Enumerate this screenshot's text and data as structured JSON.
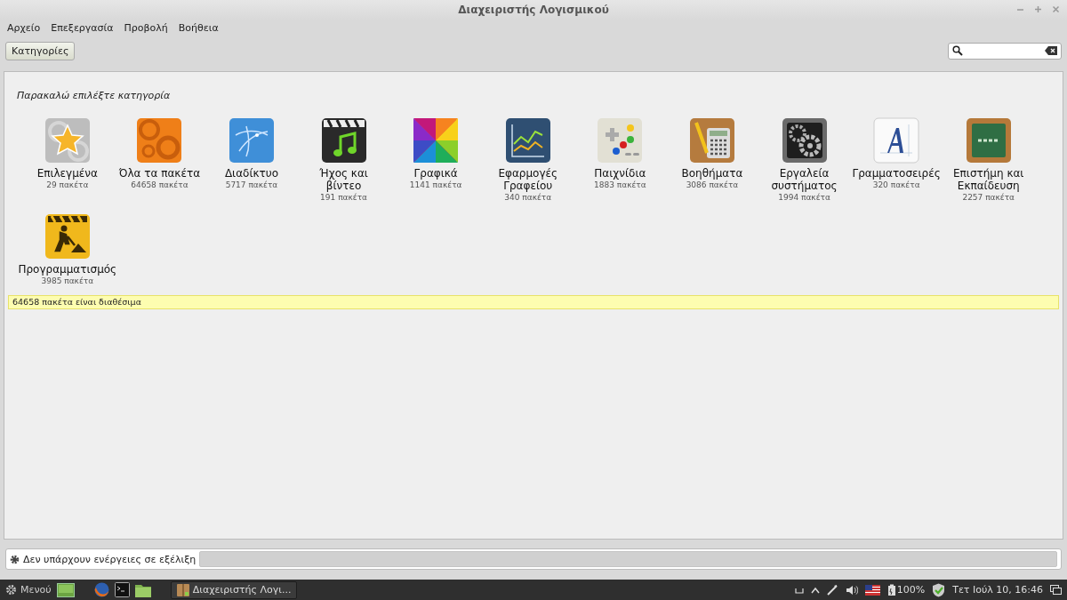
{
  "window": {
    "title": "Διαχειριστής Λογισμικού"
  },
  "menu": [
    "Αρχείο",
    "Επεξεργασία",
    "Προβολή",
    "Βοήθεια"
  ],
  "toolbar": {
    "button": "Κατηγορίες"
  },
  "heading": "Παρακαλώ επιλέξτε κατηγορία",
  "categories": [
    {
      "name": "Επιλεγμένα",
      "count": "29 πακέτα"
    },
    {
      "name": "Όλα τα πακέτα",
      "count": "64658 πακέτα"
    },
    {
      "name": "Διαδίκτυο",
      "count": "5717 πακέτα"
    },
    {
      "name": "Ήχος και βίντεο",
      "count": "191 πακέτα"
    },
    {
      "name": "Γραφικά",
      "count": "1141 πακέτα"
    },
    {
      "name": "Εφαρμογές Γραφείου",
      "count": "340 πακέτα"
    },
    {
      "name": "Παιχνίδια",
      "count": "1883 πακέτα"
    },
    {
      "name": "Βοηθήματα",
      "count": "3086 πακέτα"
    },
    {
      "name": "Εργαλεία συστήματος",
      "count": "1994 πακέτα"
    },
    {
      "name": "Γραμματοσειρές",
      "count": "320 πακέτα"
    },
    {
      "name": "Επιστήμη και Εκπαίδευση",
      "count": "2257 πακέτα"
    },
    {
      "name": "Προγραμματισμός",
      "count": "3985 πακέτα"
    }
  ],
  "notice": "64658 πακέτα είναι διαθέσιμα",
  "status_bar": {
    "text": "Δεν υπάρχουν ενέργειες σε εξέλιξη",
    "level": 0
  },
  "taskbar": {
    "menu": "Μενού",
    "window": "Διαχειριστής Λογι...",
    "battery": "100%",
    "clock": "Τετ Ιούλ 10, 16:46"
  }
}
